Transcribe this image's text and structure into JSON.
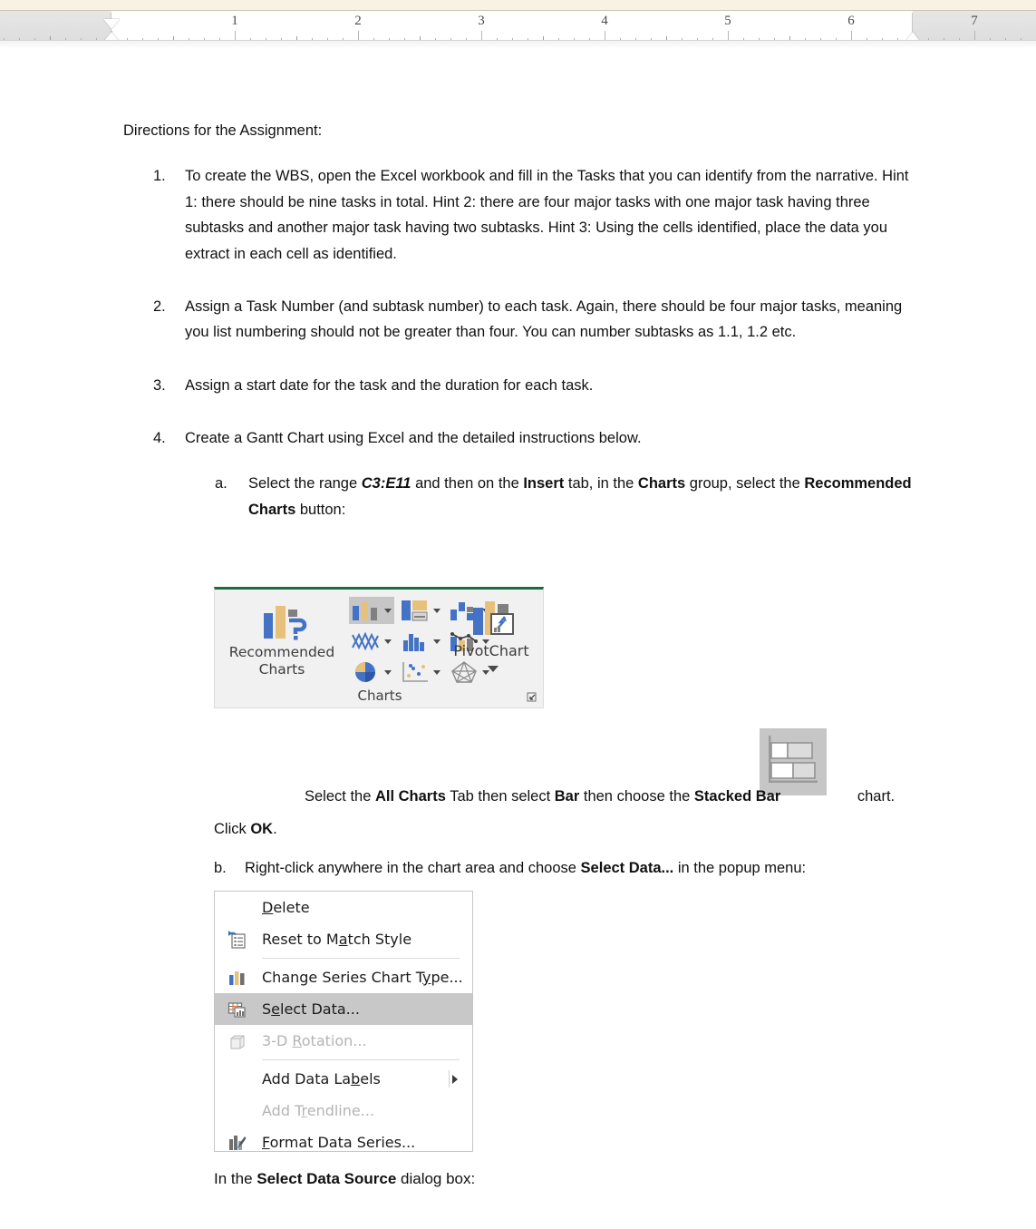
{
  "ruler": {
    "major_labels": [
      "1",
      "2",
      "3",
      "4",
      "5",
      "6",
      "7"
    ],
    "left_indent_in": 0.0,
    "right_indent_in": 6.5,
    "units": "inches"
  },
  "document": {
    "heading": "Directions for the Assignment:",
    "items": [
      {
        "num": "1.",
        "text": "To create the WBS, open the Excel workbook and fill in the Tasks that you can identify from the narrative. Hint 1: there should be nine tasks in total. Hint 2: there are four major tasks with one major task having three subtasks and another major task having two subtasks. Hint 3: Using the cells identified, place the data you extract in each cell as identified."
      },
      {
        "num": "2.",
        "text": "Assign a Task Number (and subtask number) to each task. Again, there should be four major tasks, meaning you list numbering should not be greater than four. You can number subtasks as 1.1, 1.2 etc."
      },
      {
        "num": "3.",
        "text": "Assign a start date for the task and the duration for each task."
      },
      {
        "num": "4.",
        "text": "Create a Gantt Chart using Excel and the detailed instructions below."
      }
    ],
    "sub_items": [
      {
        "num": "a.",
        "prefix": "Select the range ",
        "range": "C3:E11",
        "mid1": " and then on the ",
        "tab": "Insert",
        "mid2": " tab, in the ",
        "group": "Charts",
        "mid3": " group, select the ",
        "button": "Recommended Charts",
        "suffix": " button:"
      },
      {
        "num": "b.",
        "prefix": "Right-click anywhere in the chart area and choose ",
        "command": "Select Data...",
        "suffix": " in the popup menu:"
      }
    ],
    "all_charts_line": {
      "p1": "Select the ",
      "b1": "All Charts",
      "p2": " Tab then select ",
      "b2": "Bar",
      "p3": " then choose the ",
      "b3": "Stacked Bar",
      "p4": " chart."
    },
    "click_ok_line": {
      "p1": "Click ",
      "b1": "OK",
      "p2": "."
    },
    "final_line": {
      "p1": "In the ",
      "b1": "Select Data Source",
      "p2": " dialog box:"
    }
  },
  "ribbon_image": {
    "recommended_label_line1": "Recommended",
    "recommended_label_line2": "Charts",
    "pivotchart_label": "PivotChart",
    "group_label": "Charts",
    "gallery_buttons": [
      "insert-column-or-bar-chart",
      "insert-hierarchy-chart",
      "insert-waterfall-chart",
      "insert-line-or-area-chart",
      "insert-statistic-chart",
      "insert-combo-chart",
      "insert-pie-or-doughnut-chart",
      "insert-scatter-chart",
      "insert-surface-or-radar-chart"
    ],
    "colors": {
      "accent_blue": "#4472C4",
      "accent_tan": "#E7C07B",
      "accent_gray": "#808080",
      "excel_green": "#1E6B41",
      "panel_bg": "#F1F1F1",
      "selected_bg": "#C6C6C6"
    }
  },
  "stacked_bar_icon": {
    "name": "stacked-bar-chart-thumbnail",
    "bg": "#C6C6C6"
  },
  "context_menu": {
    "items": [
      {
        "label": "Delete",
        "accel": "D",
        "icon": null,
        "state": "normal",
        "submenu": false,
        "separator_after": false
      },
      {
        "label": "Reset to Match Style",
        "accel": "a",
        "icon": "reset-to-match-style-icon",
        "state": "normal",
        "submenu": false,
        "separator_after": true
      },
      {
        "label": "Change Series Chart Type...",
        "accel": "y",
        "icon": "change-chart-type-icon",
        "state": "normal",
        "submenu": false,
        "separator_after": false
      },
      {
        "label": "Select Data...",
        "accel": "e",
        "icon": "select-data-icon",
        "state": "selected",
        "submenu": false,
        "separator_after": false
      },
      {
        "label": "3-D Rotation...",
        "accel": "R",
        "icon": "3d-rotation-icon",
        "state": "disabled",
        "submenu": false,
        "separator_after": true
      },
      {
        "label": "Add Data Labels",
        "accel": "b",
        "icon": null,
        "state": "normal",
        "submenu": true,
        "separator_after": false
      },
      {
        "label": "Add Trendline...",
        "accel": "r",
        "icon": null,
        "state": "disabled",
        "submenu": false,
        "separator_after": false
      },
      {
        "label": "Format Data Series...",
        "accel": "F",
        "icon": "format-data-series-icon",
        "state": "normal",
        "submenu": false,
        "separator_after": false
      }
    ]
  }
}
